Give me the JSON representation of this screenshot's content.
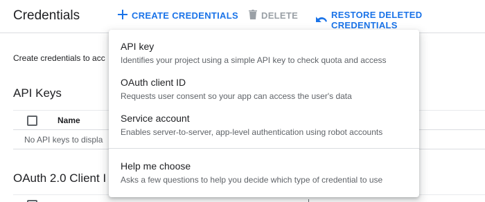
{
  "header": {
    "title": "Credentials",
    "actions": {
      "create": "CREATE CREDENTIALS",
      "delete": "DELETE",
      "restore": "RESTORE DELETED CREDENTIALS"
    }
  },
  "colors": {
    "accent": "#1a73e8",
    "disabled": "#9aa0a6",
    "text": "#202124",
    "secondary_text": "#5f6368"
  },
  "icons": {
    "create": "plus-icon",
    "delete": "trash-icon",
    "restore": "undo-icon"
  },
  "content": {
    "intro": "Create credentials to acc",
    "api_keys": {
      "title": "API Keys",
      "columns": [
        "Name"
      ],
      "empty_text": "No API keys to displa"
    },
    "oauth_clients": {
      "title": "OAuth 2.0 Client I"
    }
  },
  "menu": {
    "items": [
      {
        "label": "API key",
        "description": "Identifies your project using a simple API key to check quota and access"
      },
      {
        "label": "OAuth client ID",
        "description": "Requests user consent so your app can access the user's data"
      },
      {
        "label": "Service account",
        "description": "Enables server-to-server, app-level authentication using robot accounts"
      },
      {
        "label": "Help me choose",
        "description": "Asks a few questions to help you decide which type of credential to use"
      }
    ]
  }
}
